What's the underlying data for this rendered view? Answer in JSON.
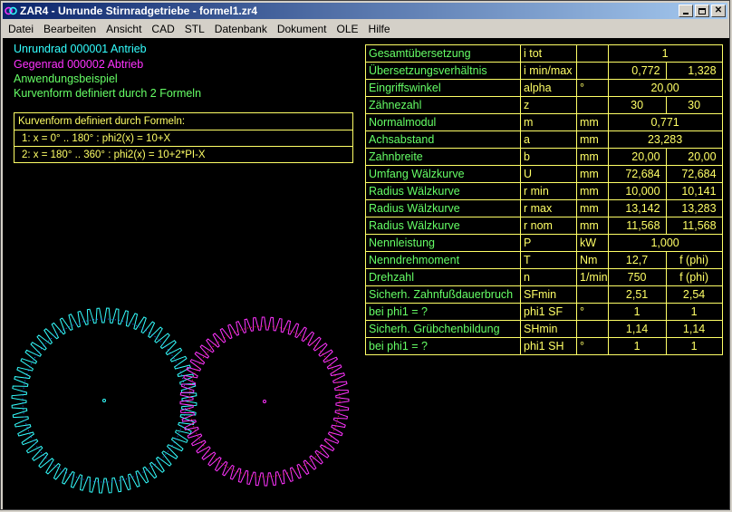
{
  "window": {
    "title": "ZAR4 - Unrunde Stirnradgetriebe  -  formel1.zr4"
  },
  "menu": [
    "Datei",
    "Bearbeiten",
    "Ansicht",
    "CAD",
    "STL",
    "Datenbank",
    "Dokument",
    "OLE",
    "Hilfe"
  ],
  "info": {
    "line1": "Unrundrad  000001  Antrieb",
    "line2": "Gegenrad  000002  Abtrieb",
    "line3": "Anwendungsbeispiel",
    "line4": "Kurvenform definiert durch 2 Formeln"
  },
  "formula_box": {
    "title": "Kurvenform definiert durch Formeln:",
    "f1": "1:  x =   0° .. 180° : phi2(x) = 10+X",
    "f2": "2:  x = 180° .. 360° : phi2(x) = 10+2*PI-X"
  },
  "colors": {
    "cyan": "#33ffff",
    "magenta": "#ff33ff",
    "yellow": "#ffff66",
    "green": "#66ff66"
  },
  "table": {
    "r0": {
      "label": "Gesamtübersetzung",
      "sym": "i tot",
      "unit": "",
      "v": "1"
    },
    "r1": {
      "label": "Übersetzungsverhältnis",
      "sym": "i min/max",
      "unit": "",
      "v1": "0,772",
      "v2": "1,328"
    },
    "r2": {
      "label": "Eingriffswinkel",
      "sym": "alpha",
      "unit": "°",
      "v": "20,00"
    },
    "r3": {
      "label": "Zähnezahl",
      "sym": "z",
      "unit": "",
      "v1": "30",
      "v2": "30"
    },
    "r4": {
      "label": "Normalmodul",
      "sym": "m",
      "unit": "mm",
      "v": "0,771"
    },
    "r5": {
      "label": "Achsabstand",
      "sym": "a",
      "unit": "mm",
      "v": "23,283"
    },
    "r6": {
      "label": "Zahnbreite",
      "sym": "b",
      "unit": "mm",
      "v1": "20,00",
      "v2": "20,00"
    },
    "r7": {
      "label": "Umfang Wälzkurve",
      "sym": "U",
      "unit": "mm",
      "v1": "72,684",
      "v2": "72,684"
    },
    "r8": {
      "label": "Radius Wälzkurve",
      "sym": "r min",
      "unit": "mm",
      "v1": "10,000",
      "v2": "10,141"
    },
    "r9": {
      "label": "Radius Wälzkurve",
      "sym": "r max",
      "unit": "mm",
      "v1": "13,142",
      "v2": "13,283"
    },
    "r10": {
      "label": "Radius Wälzkurve",
      "sym": "r nom",
      "unit": "mm",
      "v1": "11,568",
      "v2": "11,568"
    },
    "r11": {
      "label": "Nennleistung",
      "sym": "P",
      "unit": "kW",
      "v": "1,000"
    },
    "r12": {
      "label": "Nenndrehmoment",
      "sym": "T",
      "unit": "Nm",
      "v1": "12,7",
      "v2": "f (phi)"
    },
    "r13": {
      "label": "Drehzahl",
      "sym": "n",
      "unit": "1/min",
      "v1": "750",
      "v2": "f (phi)"
    },
    "r14": {
      "label": "Sicherh. Zahnfußdauerbruch",
      "sym": "SFmin",
      "unit": "",
      "v1": "2,51",
      "v2": "2,54"
    },
    "r15": {
      "label": "bei phi1 = ?",
      "sym": "phi1 SF",
      "unit": "°",
      "v1": "1",
      "v2": "1"
    },
    "r16": {
      "label": "Sicherh. Grübchenbildung",
      "sym": "SHmin",
      "unit": "",
      "v1": "1,14",
      "v2": "1,14"
    },
    "r17": {
      "label": "bei phi1 = ?",
      "sym": "phi1 SH",
      "unit": "°",
      "v1": "1",
      "v2": "1"
    }
  }
}
